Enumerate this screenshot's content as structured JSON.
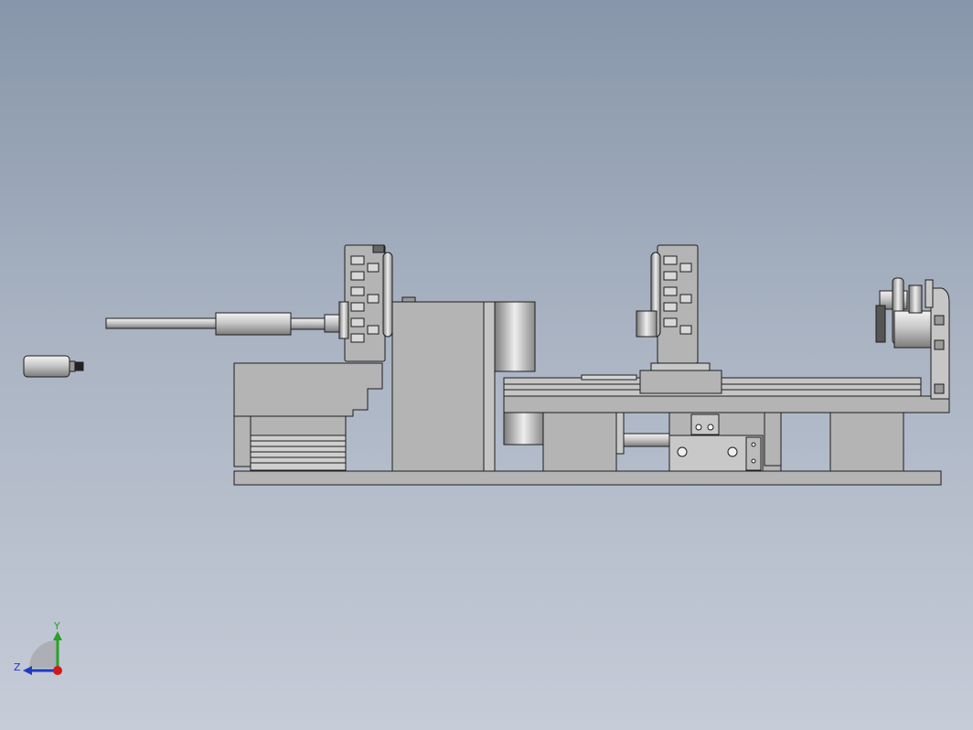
{
  "viewport": {
    "background_top": "#8796aa",
    "background_bottom": "#c6ccd8",
    "part_fill": "#b4b4b4",
    "part_stroke": "#1e1e1e"
  },
  "triad": {
    "y_label": "Y",
    "z_label": "Z",
    "y_color": "#2aa02a",
    "z_color": "#1f3bbf",
    "x_color": "#d01a1a"
  }
}
